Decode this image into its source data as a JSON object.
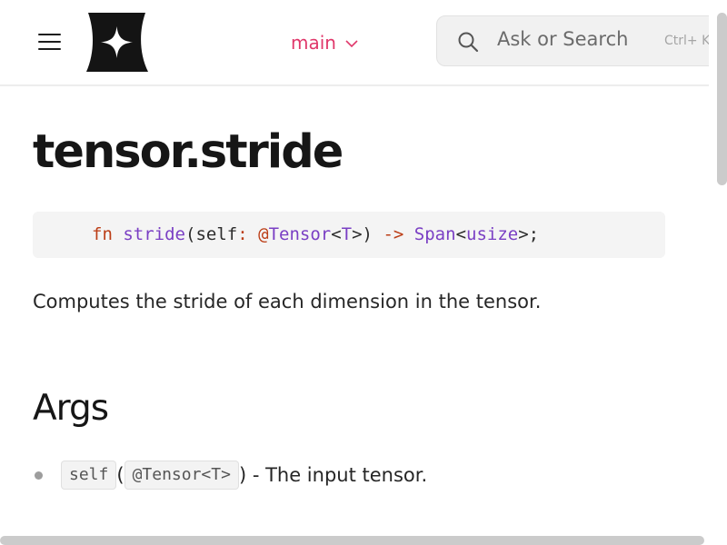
{
  "header": {
    "branch": "main",
    "search_placeholder": "Ask or Search",
    "search_shortcut": "Ctrl+ K"
  },
  "page": {
    "title": "tensor.stride",
    "signature": {
      "kw": "fn",
      "name": "stride",
      "open": "(",
      "param": "self",
      "colon": ":",
      "at": "@",
      "type": "Tensor",
      "lt": "<",
      "generic": "T",
      "gt_close": ">)",
      "arrow": "->",
      "ret_type": "Span",
      "lt2": "<",
      "ret_generic": "usize",
      "end": ">;"
    },
    "description": "Computes the stride of each dimension in the tensor.",
    "args_heading": "Args",
    "args": [
      {
        "name": "self",
        "open": "(",
        "type": "@Tensor<T>",
        "close": ")",
        "desc": " - The input tensor."
      }
    ]
  }
}
